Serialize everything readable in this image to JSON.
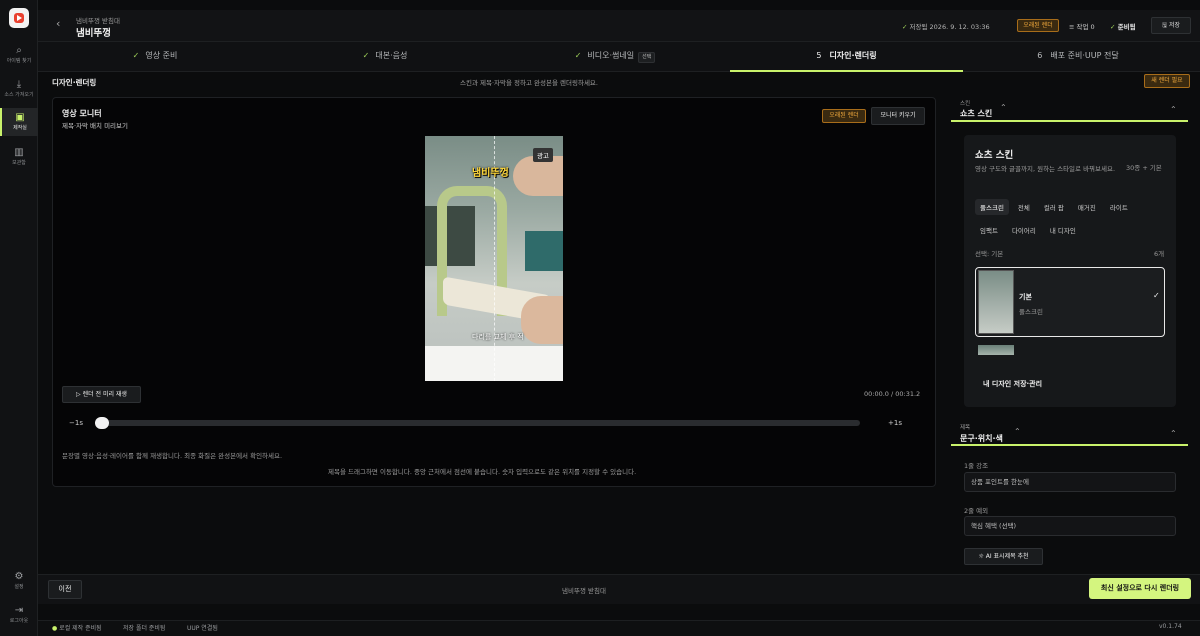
{
  "sidebar": {
    "items": [
      {
        "label": "아이템 찾기",
        "icon": "search-icon"
      },
      {
        "label": "소스 가져오기",
        "icon": "download-icon"
      },
      {
        "label": "제작실",
        "icon": "film-icon"
      },
      {
        "label": "보관함",
        "icon": "library-icon"
      }
    ],
    "settings": "설정",
    "logout": "로그아웃"
  },
  "header": {
    "breadcrumb": "냄비뚜껑 받침대",
    "title": "냄비뚜껑",
    "saved": "저장됨 2026. 9. 12. 03:36",
    "render_badge": "오래된 렌더",
    "jobs": "작업 0",
    "ready": "준비됨",
    "save": "저장"
  },
  "steps": [
    {
      "label": "영상 준비",
      "state": "done"
    },
    {
      "label": "대본·음성",
      "state": "done"
    },
    {
      "label": "비디오·썸네일",
      "state": "done",
      "chip": "선택"
    },
    {
      "label": "디자인·렌더링",
      "state": "active",
      "num": "5"
    },
    {
      "label": "배포 준비·UUP 전달",
      "state": "todo",
      "num": "6"
    }
  ],
  "section": {
    "title": "디자인·렌더링",
    "hint": "스킨과 제목·자막을 정하고 완성본을 렌더링하세요.",
    "button": "새 렌더 필요"
  },
  "monitor": {
    "title": "영상 모니터",
    "subtitle": "제목·자막 배치 미리보기",
    "badge": "오래된 렌더",
    "enlarge": "모니터 키우기",
    "ad": "광고",
    "vtitle": "냄비뚜껑",
    "vcaption": "다리를 교체 후 적",
    "play": "렌더 전 미리 재생",
    "time": "00:00.0 / 00:31.2",
    "minus": "−1s",
    "plus": "+1s",
    "progress": 0.0,
    "note1": "문장별 영상·음성·레이어를 함께 재생합니다. 최종 화질은 완성본에서 확인하세요.",
    "note2": "제목을 드래그하면 이동합니다. 중앙 근처에서 점선에 붙습니다. 숫자 입력으로도 같은 위치를 지정할 수 있습니다."
  },
  "skin": {
    "kicker": "스킨",
    "title": "쇼츠 스킨",
    "card_title": "쇼츠 스킨",
    "desc": "영상 구도와 글꼴까지, 원하는 스타일로 바꿔보세요.",
    "count": "30종 + 기본",
    "tabs": [
      "풀스크린",
      "전체",
      "컬러 팝",
      "매거진",
      "라이트",
      "임팩트",
      "다이어리",
      "내 디자인"
    ],
    "selected_label": "선택: 기본",
    "n": "6개",
    "item_name": "기본",
    "item_sub": "풀스크린",
    "my_design": "내 디자인 저장·관리"
  },
  "title_sec": {
    "kicker": "제목",
    "title": "문구·위치·색",
    "l1_label": "1줄 강조",
    "l1_value": "상품 포인트를 한눈에",
    "l2_label": "2줄 예외",
    "l2_value": "핵심 혜택 (선택)",
    "ai": "AI 표시제목 추천"
  },
  "footer": {
    "prev": "이전",
    "center": "냄비뚜껑 받침대",
    "rerender": "최신 설정으로 다시 렌더링"
  },
  "status": {
    "local": "로컬 제작 준비됨",
    "folder": "저장 폴더 준비됨",
    "uup": "UUP 연결됨",
    "version": "v0.1.74"
  },
  "colors": {
    "accent": "#c9f26b",
    "warn": "#f0a93d"
  }
}
